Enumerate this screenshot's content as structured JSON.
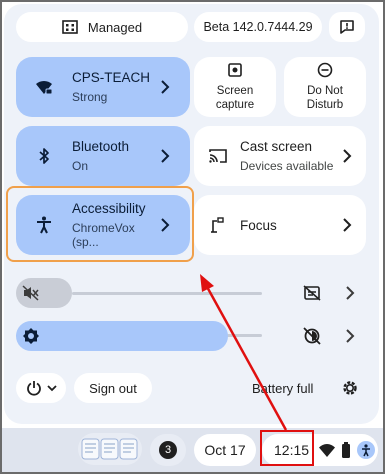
{
  "top": {
    "managed_label": "Managed",
    "version_label": "Beta 142.0.7444.29"
  },
  "tiles": {
    "network": {
      "title": "CPS-TEACH",
      "sub": "Strong"
    },
    "bluetooth": {
      "title": "Bluetooth",
      "sub": "On"
    },
    "accessibility": {
      "title": "Accessibility",
      "sub": "ChromeVox (sp..."
    },
    "screen_capture": {
      "line1": "Screen",
      "line2": "capture"
    },
    "do_not_disturb": {
      "line1": "Do Not",
      "line2": "Disturb"
    },
    "cast": {
      "title": "Cast screen",
      "sub": "Devices available"
    },
    "focus": {
      "title": "Focus"
    }
  },
  "sliders": {
    "volume_level": 0.12,
    "brightness_level": 0.73
  },
  "bottom": {
    "sign_out_label": "Sign out",
    "battery_label": "Battery full"
  },
  "shelf": {
    "notification_count": "3",
    "date": "Oct 17",
    "time": "12:15"
  },
  "colors": {
    "accent": "#a8c7fa",
    "highlight": "#f0a04b",
    "annotation": "#e01010"
  }
}
